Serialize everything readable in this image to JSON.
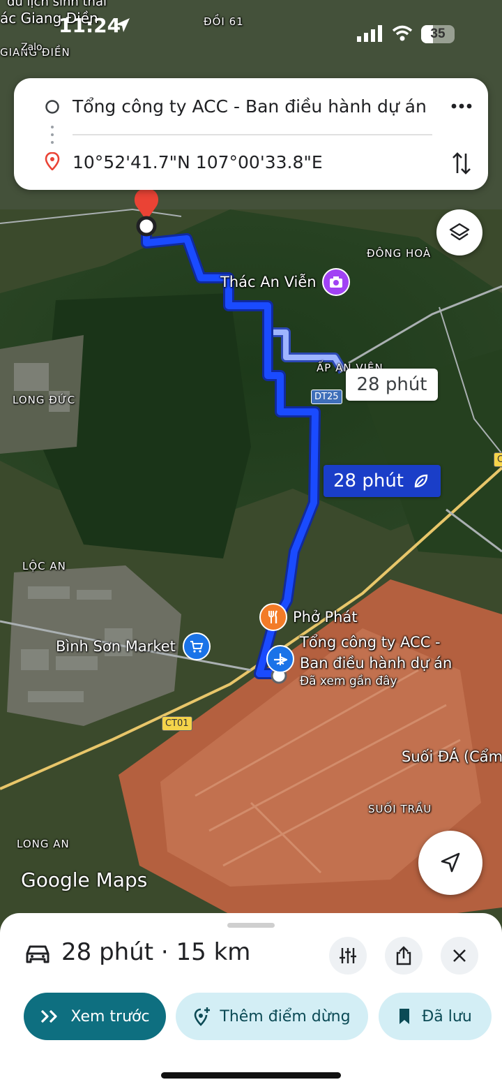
{
  "status": {
    "time": "11:24",
    "battery": "35",
    "icons": [
      "location-arrow-icon",
      "signal-icon",
      "wifi-icon",
      "battery-icon"
    ]
  },
  "route_card": {
    "origin": "Tổng công ty ACC - Ban điều hành dự án",
    "destination": "10°52'41.7\"N 107°00'33.8\"E",
    "more_icon": "more-horiz-icon",
    "swap_icon": "swap-vert-icon"
  },
  "map": {
    "place_labels": {
      "doi61": "ĐỒI 61",
      "giang_dien": "GIANG ĐIỀN",
      "dong_hoa": "ĐÔNG HOÀ",
      "ap_an_vien": "ẤP AN VIÊN",
      "long_duc": "LONG ĐỨC",
      "loc_an": "LỘC AN",
      "long_an": "LONG AN",
      "suoi_trau": "SUỐI TRẦU",
      "suoi_da": "Suối ĐÁ (Cẩm",
      "top_partial": "ác Giang Điền",
      "top_zalo": "Zalo",
      "top_partial2": "du lịch sinh thái"
    },
    "pois": {
      "thac_an_vien": "Thác An Viễn",
      "pho_phat": "Phở Phát",
      "binh_son_market": "Bình Sơn Market",
      "acc_line1": "Tổng công ty ACC -",
      "acc_line2": "Ban điều hành dự án",
      "acc_sub": "Đã xem gần đây"
    },
    "road_shields": {
      "dt25": "DT25",
      "ct01": "CT01",
      "edge": "C"
    },
    "alt_route_time": "28 phút",
    "main_route_time": "28 phút",
    "watermark": "Google Maps",
    "colors": {
      "route": "#1a4bff",
      "alt_route": "#9eb4ff",
      "route_label_bg": "#1a3ec8",
      "destination_pin": "#ea4335"
    }
  },
  "sheet": {
    "summary": "28 phút · 15 km",
    "buttons": {
      "preview": "Xem trước",
      "add_stop": "Thêm điểm dừng",
      "saved": "Đã lưu"
    },
    "colors": {
      "preview_bg": "#0e6f80",
      "secondary_bg": "#d3eef5",
      "secondary_text": "#0b4a55"
    }
  }
}
